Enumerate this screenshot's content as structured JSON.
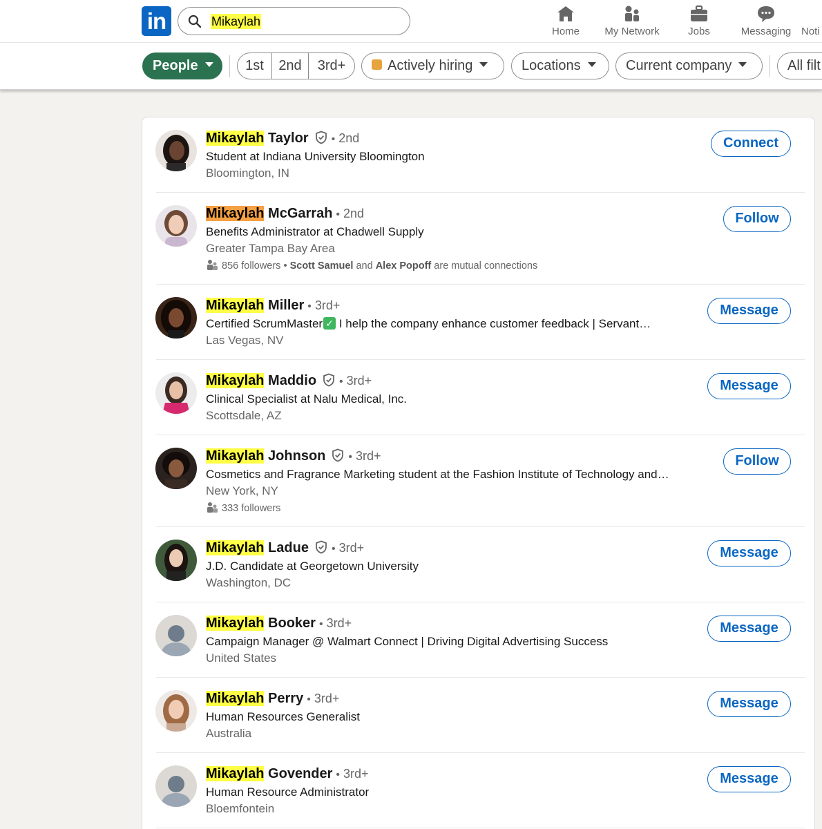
{
  "nav": {
    "logo": "in",
    "search_value": "Mikaylah",
    "items": [
      {
        "label": "Home",
        "icon": "home-icon"
      },
      {
        "label": "My Network",
        "icon": "network-icon"
      },
      {
        "label": "Jobs",
        "icon": "briefcase-icon"
      },
      {
        "label": "Messaging",
        "icon": "messaging-icon"
      },
      {
        "label": "Noti",
        "icon": "bell-icon"
      }
    ]
  },
  "filters": {
    "people": "People",
    "degrees": [
      "1st",
      "2nd",
      "3rd+"
    ],
    "actively_hiring": "Actively hiring",
    "locations": "Locations",
    "current_company": "Current company",
    "all_filters": "All filt"
  },
  "colors": {
    "brand": "#0a66c2",
    "people_pill": "#2b7250",
    "highlight": "#ffff45",
    "highlight_alt": "#f5a043"
  },
  "results": [
    {
      "first": "Mikaylah",
      "last": "Taylor",
      "verified": true,
      "degree": "2nd",
      "headline": "Student at Indiana University Bloomington",
      "location": "Bloomington, IN",
      "action": "Connect"
    },
    {
      "first": "Mikaylah",
      "last": "McGarrah",
      "verified": false,
      "degree": "2nd",
      "headline": "Benefits Administrator at Chadwell Supply",
      "location": "Greater Tampa Bay Area",
      "followers": "856 followers",
      "mutual_a": "Scott Samuel",
      "mutual_and": "and",
      "mutual_b": "Alex Popoff",
      "mutual_suffix": "are mutual connections",
      "action": "Follow"
    },
    {
      "first": "Mikaylah",
      "last": "Miller",
      "verified": false,
      "degree": "3rd+",
      "headline_a": "Certified ScrumMaster",
      "headline_b": " I help the company enhance customer feedback | Servant…",
      "location": "Las Vegas, NV",
      "action": "Message"
    },
    {
      "first": "Mikaylah",
      "last": "Maddio",
      "verified": true,
      "degree": "3rd+",
      "headline": "Clinical Specialist at Nalu Medical, Inc.",
      "location": "Scottsdale, AZ",
      "action": "Message"
    },
    {
      "first": "Mikaylah",
      "last": "Johnson",
      "verified": true,
      "degree": "3rd+",
      "headline": "Cosmetics and Fragrance Marketing student at the Fashion Institute of Technology and…",
      "location": "New York, NY",
      "followers": "333 followers",
      "action": "Follow"
    },
    {
      "first": "Mikaylah",
      "last": "Ladue",
      "verified": true,
      "degree": "3rd+",
      "headline": "J.D. Candidate at Georgetown University",
      "location": "Washington, DC",
      "action": "Message"
    },
    {
      "first": "Mikaylah",
      "last": "Booker",
      "verified": false,
      "degree": "3rd+",
      "headline": "Campaign Manager @ Walmart Connect | Driving Digital Advertising Success",
      "location": "United States",
      "action": "Message"
    },
    {
      "first": "Mikaylah",
      "last": "Perry",
      "verified": false,
      "degree": "3rd+",
      "headline": "Human Resources Generalist",
      "location": "Australia",
      "action": "Message"
    },
    {
      "first": "Mikaylah",
      "last": "Govender",
      "verified": false,
      "degree": "3rd+",
      "headline": "Human Resource Administrator",
      "location": "Bloemfontein",
      "action": "Message"
    }
  ]
}
